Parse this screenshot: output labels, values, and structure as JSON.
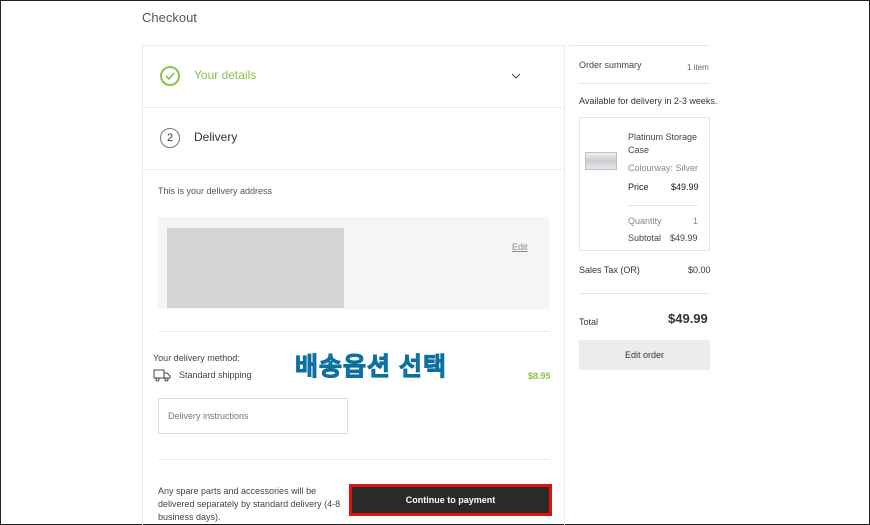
{
  "header": {
    "title": "Checkout"
  },
  "steps": {
    "details": {
      "title": "Your details"
    },
    "delivery": {
      "number": "2",
      "title": "Delivery"
    }
  },
  "delivery": {
    "address_intro": "This is your delivery address",
    "edit_label": "Edit",
    "method_label": "Your delivery method:",
    "method_name": "Standard shipping",
    "method_price": "$8.95",
    "instructions_placeholder": "Delivery instructions",
    "spare_parts_note": "Any spare parts and accessories will be delivered separately by standard delivery (4-8 business days).",
    "continue_label": "Continue to payment"
  },
  "overlay": {
    "text": "배송옵션 선택"
  },
  "summary": {
    "title": "Order summary",
    "count": "1 item",
    "availability": "Available for delivery in 2-3 weeks.",
    "item": {
      "name": "Platinum Storage Case",
      "colourway": "Colourway: Silver",
      "price_label": "Price",
      "price": "$49.99",
      "quantity_label": "Quantity",
      "quantity": "1",
      "subtotal_label": "Subtotal",
      "subtotal": "$49.99"
    },
    "tax_label": "Sales Tax  (OR)",
    "tax": "$0.00",
    "total_label": "Total",
    "total": "$49.99",
    "edit_order_label": "Edit order"
  },
  "colors": {
    "accent_green": "#8bc34a",
    "highlight_red": "#e01010",
    "button_dark": "#2a2a2a"
  },
  "icons": [
    "check-icon",
    "chevron-down-icon",
    "truck-icon"
  ]
}
